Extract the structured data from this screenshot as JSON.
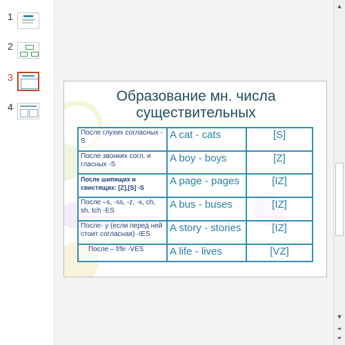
{
  "thumbnails": [
    {
      "number": "1",
      "selected": false
    },
    {
      "number": "2",
      "selected": false
    },
    {
      "number": "3",
      "selected": true
    },
    {
      "number": "4",
      "selected": false
    }
  ],
  "slide": {
    "title_line1": "Образование мн. числа",
    "title_line2": "существительных",
    "rows": [
      {
        "rule": "После глухих согласных -S",
        "example": "A cat - cats",
        "sound": "[S]"
      },
      {
        "rule": "После звонких согл. и гласных -S",
        "example": "A boy - boys",
        "sound": "[Z]"
      },
      {
        "rule": "После шипящих и свистящих: [Z],[S] -S",
        "example": "A page - pages",
        "sound": "[IZ]"
      },
      {
        "rule": "После –s, -ss, -z, -x, ch, sh, tch -ES",
        "example": "A bus - buses",
        "sound": "[IZ]"
      },
      {
        "rule": "После- y (если перед ней стоит согласная) -IES",
        "example": "A story - stories",
        "sound": "[IZ]"
      },
      {
        "rule": "После – f/fe -VES",
        "example": "A life - lives",
        "sound": "[VZ]"
      }
    ]
  },
  "scrollbar": {
    "up_icon": "▲",
    "down_icon": "▼",
    "prev_slide_icon": "⏶",
    "next_slide_icon": "⏷"
  },
  "colors": {
    "selected_thumb_border": "#c8421f",
    "table_border": "#2f8db2",
    "title": "#1f4e5a",
    "cell_text": "#2a7fa3"
  }
}
